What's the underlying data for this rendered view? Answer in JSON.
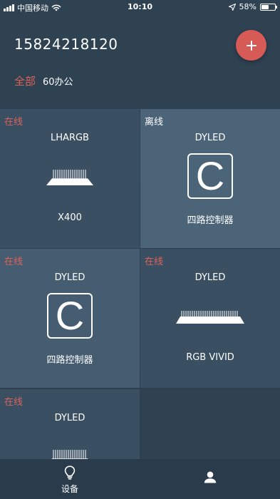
{
  "status_bar": {
    "carrier": "中国移动",
    "time": "10:10",
    "battery": "58%",
    "battery_level": 0.58,
    "icons": [
      "signal-icon",
      "wifi-icon",
      "location-icon",
      "battery-icon"
    ]
  },
  "header": {
    "phone": "15824218120",
    "add_icon": "plus-icon",
    "add_color": "#d65a55"
  },
  "filter": {
    "all_label": "全部",
    "group_label": "60办公"
  },
  "colors": {
    "online": "#d9635c",
    "accent": "#d65a55"
  },
  "devices": [
    {
      "status": "在线",
      "brand": "LHARGB",
      "model": "X400",
      "icon": "led-strip-icon"
    },
    {
      "status": "离线",
      "brand": "DYLED",
      "icon_letter": "C",
      "model": "四路控制器",
      "icon": "controller-c-icon"
    },
    {
      "status": "在线",
      "brand": "DYLED",
      "icon_letter": "C",
      "model": "四路控制器",
      "icon": "controller-c-icon"
    },
    {
      "status": "在线",
      "brand": "DYLED",
      "model": "RGB VIVID",
      "icon": "led-strip-icon"
    },
    {
      "status": "在线",
      "brand": "DYLED",
      "icon": "led-strip-icon"
    }
  ],
  "tabs": [
    {
      "label": "设备",
      "icon": "lightbulb-icon"
    },
    {
      "label": "",
      "icon": "person-icon"
    }
  ]
}
